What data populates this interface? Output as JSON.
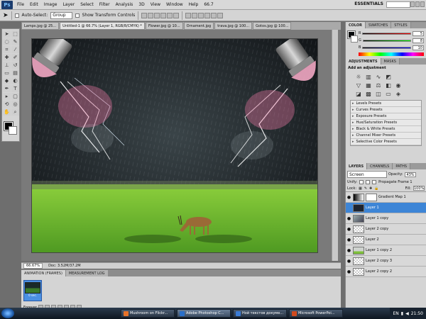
{
  "app": {
    "logo": "Ps",
    "zoom_label": "66.7",
    "workspace": "ESSENTIALS"
  },
  "menu": [
    "File",
    "Edit",
    "Image",
    "Layer",
    "Select",
    "Filter",
    "Analysis",
    "3D",
    "View",
    "Window",
    "Help"
  ],
  "options": {
    "auto_select_label": "Auto-Select:",
    "auto_select_value": "Group",
    "transform_label": "Show Transform Controls"
  },
  "doc_tabs": [
    {
      "label": "Lamps.jpg @ 25...",
      "active": false
    },
    {
      "label": "Untitled-1 @ 66.7% (Layer 1, RGB/8/CMYK) *",
      "active": true
    },
    {
      "label": "Flower.jpg @ 10...",
      "active": false
    },
    {
      "label": "Ornament.jpg",
      "active": false
    },
    {
      "label": "trava.jpg @ 100...",
      "active": false
    },
    {
      "label": "Gotos.jpg @ 100...",
      "active": false
    }
  ],
  "status": {
    "zoom": "66.67%",
    "doc": "Doc: 3.52M/37.2M"
  },
  "anim": {
    "tabs": [
      "ANIMATION (FRAMES)",
      "MEASUREMENT LOG"
    ],
    "frame_delay": "0 sec.",
    "loop": "Forever"
  },
  "color_panel": {
    "tabs": [
      "COLOR",
      "SWATCHES",
      "STYLES"
    ],
    "channels": [
      {
        "label": "R",
        "value": "5"
      },
      {
        "label": "G",
        "value": "8"
      },
      {
        "label": "B",
        "value": "10"
      }
    ]
  },
  "adjustments": {
    "tabs": [
      "ADJUSTMENTS",
      "MASKS"
    ],
    "heading": "Add an adjustment",
    "presets": [
      "Levels Presets",
      "Curves Presets",
      "Exposure Presets",
      "Hue/Saturation Presets",
      "Black & White Presets",
      "Channel Mixer Presets",
      "Selective Color Presets"
    ]
  },
  "layers": {
    "tabs": [
      "LAYERS",
      "CHANNELS",
      "PATHS"
    ],
    "blend_mode": "Screen",
    "opacity_label": "Opacity:",
    "opacity": "43%",
    "unify_label": "Unify:",
    "propagate_label": "Propagate Frame 1",
    "lock_label": "Lock:",
    "fill_label": "Fill:",
    "fill": "100%",
    "items": [
      {
        "name": "Gradient Map 1",
        "thumb": "map",
        "selected": false,
        "visible": true,
        "mask": true
      },
      {
        "name": "Layer 1",
        "thumb": "dark",
        "selected": true,
        "visible": false,
        "mask": false
      },
      {
        "name": "Layer 1 copy",
        "thumb": "tex",
        "selected": false,
        "visible": true,
        "mask": false
      },
      {
        "name": "Layer 2 copy",
        "thumb": "checker",
        "selected": false,
        "visible": true,
        "mask": false
      },
      {
        "name": "Layer 2",
        "thumb": "checker",
        "selected": false,
        "visible": true,
        "mask": false
      },
      {
        "name": "Layer 1 copy 2",
        "thumb": "grass",
        "selected": false,
        "visible": true,
        "mask": false
      },
      {
        "name": "Layer 2 copy 3",
        "thumb": "checker",
        "selected": false,
        "visible": true,
        "mask": false
      },
      {
        "name": "Layer 2 copy 2",
        "thumb": "checker",
        "selected": false,
        "visible": true,
        "mask": false
      }
    ]
  },
  "taskbar": {
    "items": [
      {
        "label": "Mushroom on Flickr...",
        "color": "#e8732a",
        "active": false
      },
      {
        "label": "Adobe Photoshop C...",
        "color": "#2a6fc9",
        "active": true
      },
      {
        "label": "Ной текстов докуме...",
        "color": "#3a7bd5",
        "active": false
      },
      {
        "label": "Microsoft PowerPoi...",
        "color": "#d04a1e",
        "active": false
      }
    ],
    "lang": "EN",
    "time": "21:50"
  }
}
